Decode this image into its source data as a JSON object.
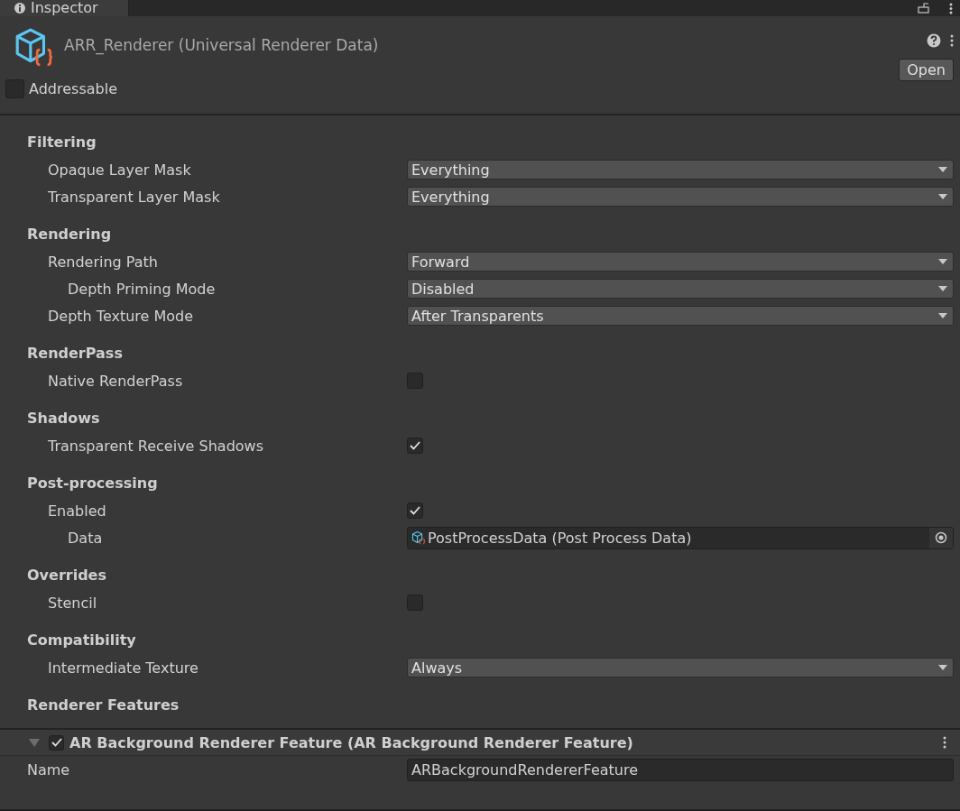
{
  "tab": {
    "label": "Inspector",
    "selected": true
  },
  "header": {
    "title": "ARR_Renderer (Universal Renderer Data)",
    "open_button": "Open",
    "addressable": {
      "label": "Addressable",
      "checked": false
    }
  },
  "sections": [
    {
      "title": "Filtering",
      "rows": [
        {
          "kind": "dropdown",
          "label": "Opaque Layer Mask",
          "value": "Everything"
        },
        {
          "kind": "dropdown",
          "label": "Transparent Layer Mask",
          "value": "Everything"
        }
      ]
    },
    {
      "title": "Rendering",
      "rows": [
        {
          "kind": "dropdown",
          "label": "Rendering Path",
          "value": "Forward",
          "children": [
            {
              "kind": "dropdown",
              "label": "Depth Priming Mode",
              "value": "Disabled"
            }
          ]
        },
        {
          "kind": "dropdown",
          "label": "Depth Texture Mode",
          "value": "After Transparents"
        }
      ]
    },
    {
      "title": "RenderPass",
      "rows": [
        {
          "kind": "checkbox",
          "label": "Native RenderPass",
          "checked": false
        }
      ]
    },
    {
      "title": "Shadows",
      "rows": [
        {
          "kind": "checkbox",
          "label": "Transparent Receive Shadows",
          "checked": true
        }
      ]
    },
    {
      "title": "Post-processing",
      "rows": [
        {
          "kind": "checkbox",
          "label": "Enabled",
          "checked": true,
          "children": [
            {
              "kind": "object",
              "label": "Data",
              "value": "PostProcessData (Post Process Data)"
            }
          ]
        }
      ]
    },
    {
      "title": "Overrides",
      "rows": [
        {
          "kind": "checkbox",
          "label": "Stencil",
          "checked": false
        }
      ]
    },
    {
      "title": "Compatibility",
      "rows": [
        {
          "kind": "dropdown",
          "label": "Intermediate Texture",
          "value": "Always"
        }
      ]
    },
    {
      "title": "Renderer Features"
    }
  ],
  "features": [
    {
      "title": "AR Background Renderer Feature (AR Background Renderer Feature)",
      "expanded": true,
      "enabled": true,
      "name_label": "Name",
      "name_value": "ARBackgroundRendererFeature"
    }
  ]
}
